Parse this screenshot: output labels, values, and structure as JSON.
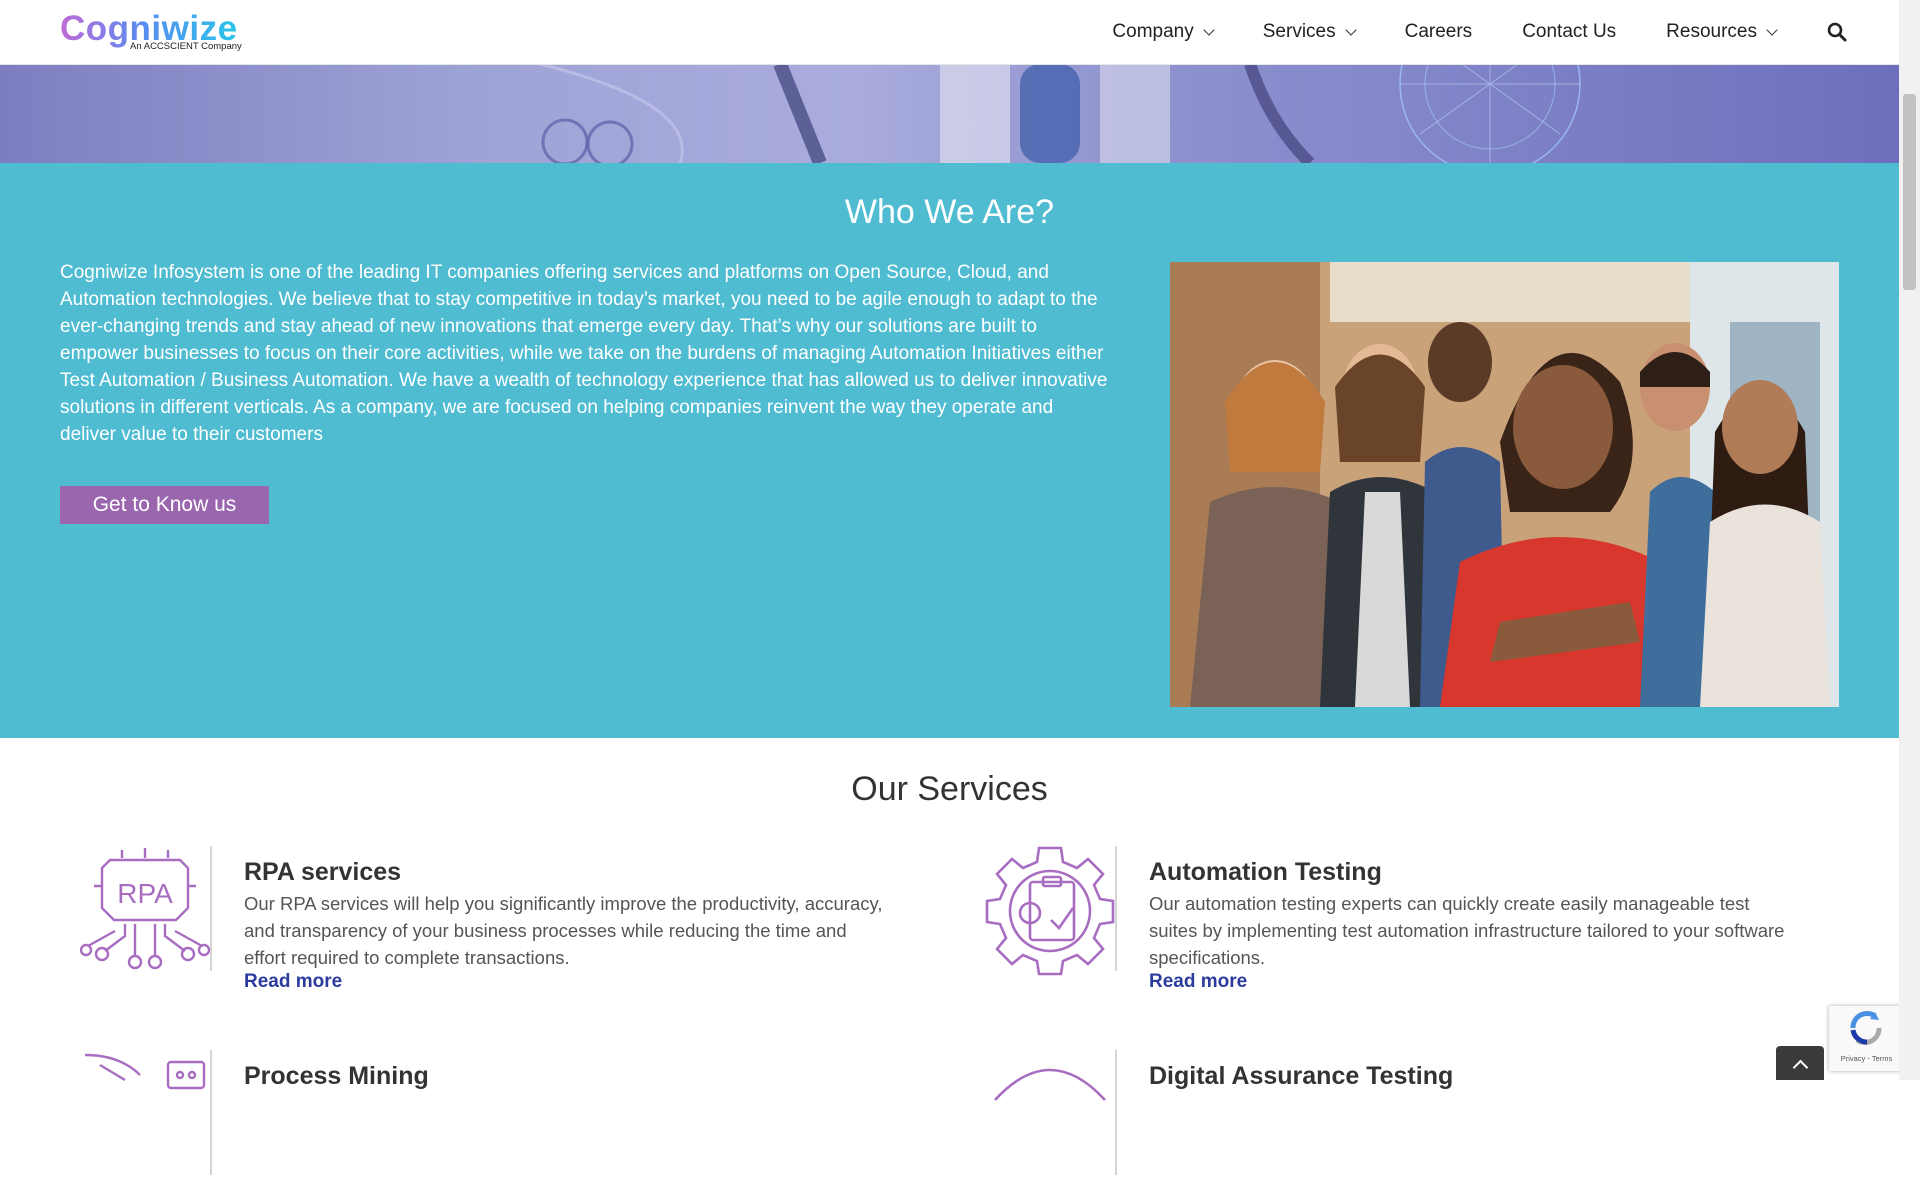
{
  "brand": {
    "name": "Cogniwize",
    "tagline": "An ACCSCIENT Company"
  },
  "nav": {
    "items": [
      {
        "label": "Company",
        "has_dropdown": true
      },
      {
        "label": "Services",
        "has_dropdown": true
      },
      {
        "label": "Careers",
        "has_dropdown": false
      },
      {
        "label": "Contact Us",
        "has_dropdown": false
      },
      {
        "label": "Resources",
        "has_dropdown": true
      }
    ],
    "search_icon": "search-icon"
  },
  "who": {
    "title": "Who We Are?",
    "text": "Cogniwize Infosystem is one of the leading IT companies offering services and platforms on Open Source, Cloud, and Automation technologies. We believe that to stay competitive in today’s market, you need to be agile enough to adapt to the ever-changing trends and stay ahead of new innovations that emerge every day. That’s why our solutions are built to empower businesses to focus on their core activities, while we take on the burdens of managing Automation Initiatives either Test Automation / Business Automation. We have a wealth of technology experience that has allowed us to deliver innovative solutions in different verticals. As a company, we are focused on helping companies reinvent the way they operate and deliver value to their customers",
    "button": "Get to Know us"
  },
  "services": {
    "title": "Our Services",
    "items": [
      {
        "name": "RPA services",
        "desc": "Our RPA services will help you significantly improve the productivity, accuracy, and transparency of your business processes while reducing the time and effort required to complete transactions.",
        "more": "Read more",
        "icon_text": "RPA"
      },
      {
        "name": "Automation Testing",
        "desc": "Our automation testing experts can quickly create easily manageable test suites by implementing test automation infrastructure tailored to your software specifications.",
        "more": "Read more"
      },
      {
        "name": "Process Mining"
      },
      {
        "name": "Digital Assurance Testing"
      }
    ]
  },
  "widgets": {
    "recaptcha_text": "Privacy - Terms"
  },
  "colors": {
    "teal": "#4fbcd2",
    "purple": "#9a66ae",
    "icon_purple": "#a86cc1",
    "link_blue": "#2c3c9e"
  }
}
